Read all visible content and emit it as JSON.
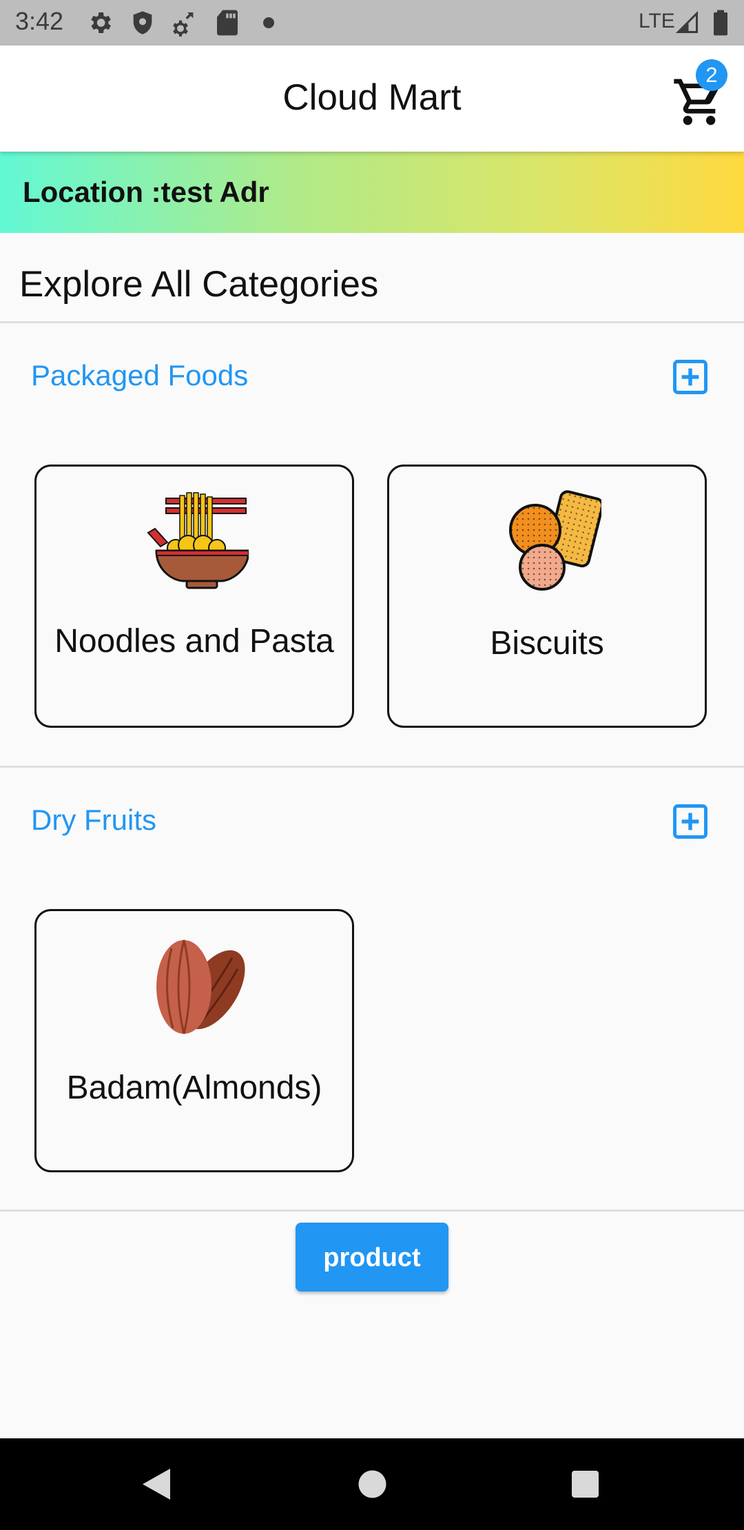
{
  "status_bar": {
    "time": "3:42",
    "network": "LTE",
    "icons": [
      "gear-icon",
      "shield-icon",
      "settings-sync-icon",
      "sd-card-icon",
      "dot-icon",
      "signal-icon",
      "battery-icon"
    ]
  },
  "app_bar": {
    "title": "Cloud Mart",
    "cart_count": "2",
    "cart_icon": "cart-icon"
  },
  "location": {
    "text": "Location :test Adr"
  },
  "heading": "Explore All Categories",
  "categories": [
    {
      "title": "Packaged Foods",
      "add_icon": "add-box-icon",
      "items": [
        {
          "label": "Noodles and Pasta",
          "icon": "noodles-bowl-icon"
        },
        {
          "label": "Biscuits",
          "icon": "biscuits-icon"
        }
      ]
    },
    {
      "title": "Dry Fruits",
      "add_icon": "add-box-icon",
      "items": [
        {
          "label": "Badam(Almonds)",
          "icon": "almonds-icon"
        }
      ]
    }
  ],
  "product_button": {
    "label": "product"
  },
  "nav_bar": {
    "icons": [
      "back-icon",
      "home-icon",
      "recents-icon"
    ]
  },
  "colors": {
    "accent": "#2196f3",
    "status_bar": "#bdbdbd",
    "gradient_start": "#62f8d5",
    "gradient_end": "#fed93f"
  }
}
